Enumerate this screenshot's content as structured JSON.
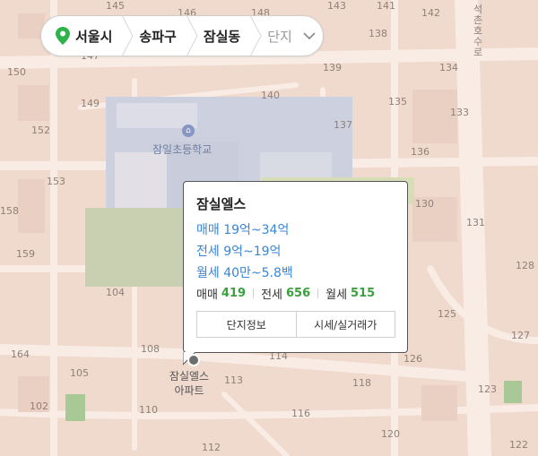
{
  "breadcrumb": {
    "city": "서울시",
    "district": "송파구",
    "dong": "잠실동",
    "complex_placeholder": "단지"
  },
  "map": {
    "school_label": "잠일초등학교",
    "road_label": "석촌호수로",
    "block_numbers": [
      "145",
      "146",
      "147",
      "148",
      "149",
      "150",
      "152",
      "153",
      "158",
      "159",
      "164",
      "102",
      "104",
      "105",
      "108",
      "110",
      "112",
      "113",
      "114",
      "116",
      "118",
      "120",
      "122",
      "123",
      "125",
      "126",
      "127",
      "128",
      "130",
      "131",
      "133",
      "134",
      "135",
      "136",
      "137",
      "138",
      "139",
      "140",
      "141",
      "142",
      "143"
    ]
  },
  "popup": {
    "title": "잠실엘스",
    "sale_range": "매매 19억~34억",
    "jeonse_range": "전세 9억~19억",
    "monthly_range": "월세 40만~5.8백",
    "sale_label": "매매",
    "sale_count": "419",
    "jeonse_label": "전세",
    "jeonse_count": "656",
    "monthly_label": "월세",
    "monthly_count": "515",
    "info_button": "단지정보",
    "price_button": "시세/실거래가"
  },
  "marker": {
    "name_line1": "잠실엘스",
    "name_line2": "아파트"
  },
  "colors": {
    "map_bg": "#f0d9cd",
    "price_link": "#3a85d6",
    "count_green": "#3aa03f"
  }
}
